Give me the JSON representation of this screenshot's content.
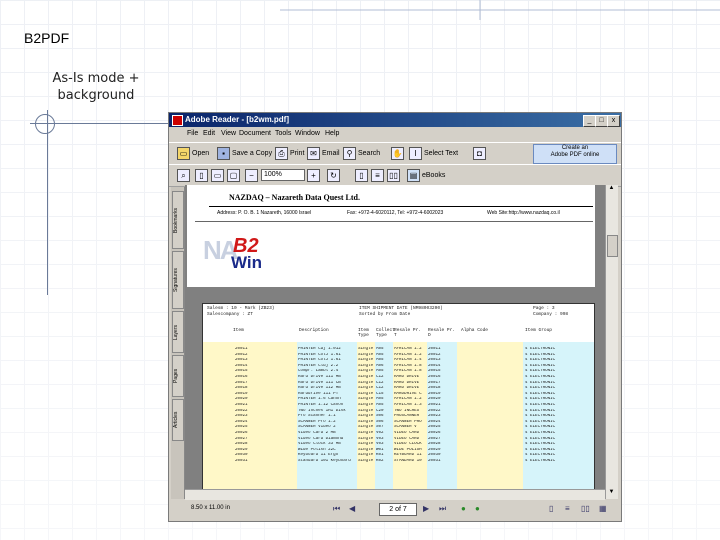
{
  "slide": {
    "title": "B2PDF",
    "subtitle_line1": "As-Is mode +",
    "subtitle_line2": "background"
  },
  "window": {
    "title": "Adobe Reader - [b2wm.pdf]",
    "controls": [
      "_",
      "□",
      "x"
    ],
    "menu": [
      "File",
      "Edit",
      "View",
      "Document",
      "Tools",
      "Window",
      "Help"
    ],
    "toolbar1": {
      "open": "Open",
      "save_copy": "Save a Copy",
      "print": "Print",
      "email": "Email",
      "search": "Search",
      "select_text": "Select Text"
    },
    "adobe_button_line1": "Create an",
    "adobe_button_line2": "Adobe PDF online",
    "zoom": "100%",
    "books_label": "eBooks"
  },
  "side_tabs": [
    "Bookmarks",
    "Signatures",
    "Layers",
    "Pages",
    "Articles"
  ],
  "document": {
    "company_title": "NAZDAQ – Nazareth Data Quest Ltd.",
    "address": "Address: P. O. B. 1 Nazareth, 16000 Israel",
    "fax_tel": "Fax: +972-4-6020112, Tel: +972-4-6002023",
    "website": "Web Site:http://www.nazdaq.co.il",
    "logo_text_line1": "B2",
    "logo_text_line2": "Win",
    "report": {
      "left_header_1": "Salesm : 10 - Mark (ZB23)",
      "left_header_2": "Salescompany : ZT",
      "mid_header_1": "ITEM SHIPMENT DATE (NM98003200)",
      "mid_header_2": "Sorted by       From Date",
      "right_header_1": "Page    :  3",
      "right_header_2": "Company :  998",
      "columns": [
        "Item",
        "Description",
        "Item Type",
        "Collect Type",
        "Resale Pr. T",
        "Resale Pr. D",
        "Alpha Code",
        "Item Group"
      ],
      "rows": [
        [
          "20011",
          "PRINTER Cdj 1.012",
          "Single",
          "A05",
          "AFRICAN 1.2",
          "20011",
          "",
          "4 ELECTRONIC"
        ],
        [
          "20012",
          "PRINTER ColJ 1.61",
          "Single",
          "A05",
          "AFRICAN 1.2",
          "20012",
          "",
          "4 ELECTRONIC"
        ],
        [
          "20013",
          "PRINTER ColJ 1.61",
          "Single",
          "A05",
          "AFRICAN 1.4",
          "20013",
          "",
          "4 ELECTRONIC"
        ],
        [
          "20014",
          "PRINTER Cldj 2.2",
          "Single",
          "A06",
          "AFRICAN 1.8",
          "20014",
          "",
          "4 ELECTRONIC"
        ],
        [
          "20015",
          "Compr. Lambl 2.4",
          "Single",
          "A05",
          "AFRICAN 1.8",
          "20015",
          "",
          "4 ELECTRONIC"
        ],
        [
          "20016",
          "Hard Drive 111 MB",
          "Single",
          "C12",
          "HARD DRIVE",
          "20016",
          "",
          "4 ELECTRONIC"
        ],
        [
          "20017",
          "Hard Drive 111 CB",
          "Single",
          "C12",
          "HARD DRIVE",
          "20017",
          "",
          "4 ELECTRONIC"
        ],
        [
          "20018",
          "Hard Drive 112 MB",
          "Single",
          "C12",
          "HARD DRIVE",
          "20018",
          "",
          "4 ELECTRONIC"
        ],
        [
          "20019",
          "Harddrive 111 PT",
          "Single",
          "C15",
          "HARDDRIVE C",
          "20019",
          "",
          "4 ELECTRONIC"
        ],
        [
          "20020",
          "PRINTER 1.6 Canon",
          "Single",
          "A05",
          "AFRICAN 1.2",
          "20020",
          "",
          "4 ELECTRONIC"
        ],
        [
          "20021",
          "PRINTER 1.12 Canon",
          "Single",
          "A05",
          "AFRICAN 1.3",
          "20021",
          "",
          "4 ELECTRONIC"
        ],
        [
          "20022",
          "Two Inches 1H1 Disk",
          "Single",
          "C20",
          "TWO INCHES",
          "20022",
          "",
          "4 ELECTRONIC"
        ],
        [
          "20023",
          "Pro Scanner 1.1",
          "Single",
          "S06",
          "PROSCANNER",
          "20023",
          "",
          "4 ELECTRONIC"
        ],
        [
          "20024",
          "SCANNER Pro 1.2",
          "Single",
          "S06",
          "SCANNER PRO",
          "20024",
          "",
          "4 ELECTRONIC"
        ],
        [
          "20025",
          "SCANNER Video 2",
          "Single",
          "S07",
          "SCANNER V",
          "20025",
          "",
          "4 ELECTRONIC"
        ],
        [
          "20026",
          "Video Card 2 MB",
          "Single",
          "V02",
          "VIDEO CARD",
          "20026",
          "",
          "4 ELECTRONIC"
        ],
        [
          "20027",
          "Video Card Diamond",
          "Single",
          "V03",
          "VIDEO CARD",
          "20027",
          "",
          "4 ELECTRONIC"
        ],
        [
          "20028",
          "Video Clock 33 MB",
          "Single",
          "V03",
          "VIDEO CLOCK",
          "20028",
          "",
          "4 ELECTRONIC"
        ],
        [
          "20029",
          "Wide Polish 22C",
          "Single",
          "W01",
          "WIDE POLISH",
          "20029",
          "",
          "4 ELECTRONIC"
        ],
        [
          "20030",
          "Keyboard 11 Ergo",
          "Single",
          "K01",
          "KEYBOARD 11",
          "20030",
          "",
          "4 ELECTRONIC"
        ],
        [
          "20031",
          "Standard 101 Keyboard",
          "Single",
          "K02",
          "STANDARD 10",
          "20031",
          "",
          "4 ELECTRONIC"
        ]
      ]
    }
  },
  "statusbar": {
    "page_size": "8.50 x 11.00 in",
    "page_indicator": "2 of 7"
  },
  "colors": {
    "title_gradient_start": "#0a246a",
    "title_gradient_end": "#3a6ea5",
    "col_yellow": "#fff8c8",
    "col_cyan": "#d6f4fa",
    "logo_red": "#d01818",
    "logo_blue": "#1a2a8a"
  }
}
